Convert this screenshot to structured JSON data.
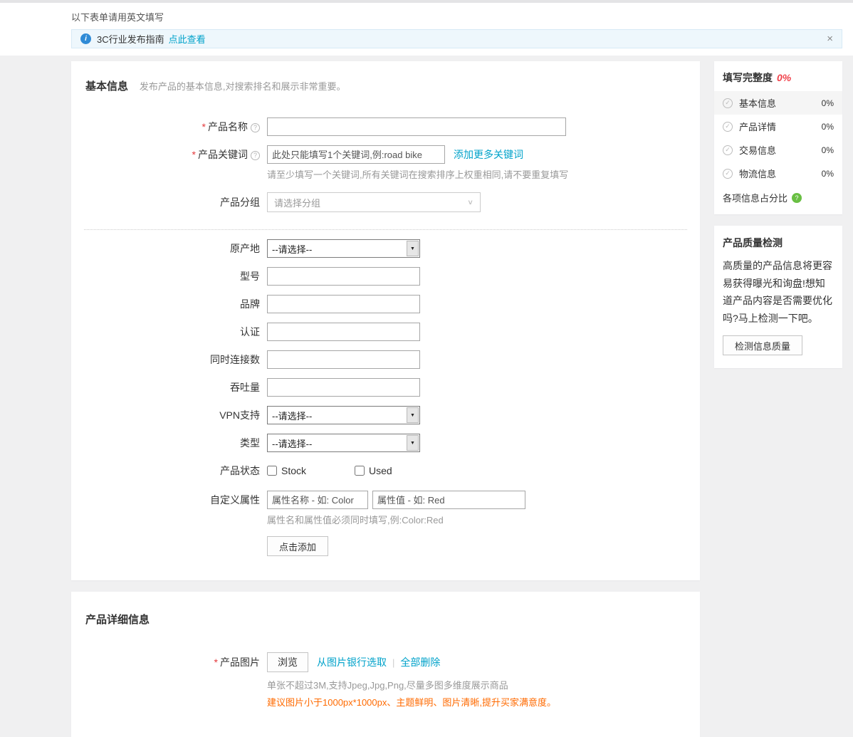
{
  "icons": {
    "info": "i",
    "help": "?",
    "check": "✓",
    "question": "?",
    "close": "×",
    "chevron": "∨",
    "select_arrow": "▼"
  },
  "marks": {
    "required": "*",
    "pipe": "|"
  },
  "top_note": "以下表单请用英文填写",
  "banner": {
    "title": "3C行业发布指南",
    "link": "点此查看"
  },
  "basic": {
    "title": "基本信息",
    "subtitle": "发布产品的基本信息,对搜索排名和展示非常重要。",
    "name_label": "产品名称",
    "keyword_label": "产品关键词",
    "keyword_placeholder": "此处只能填写1个关键词,例:road bike",
    "keyword_add_link": "添加更多关键词",
    "keyword_help": "请至少填写一个关键词,所有关键词在搜索排序上权重相同,请不要重复填写",
    "group_label": "产品分组",
    "group_placeholder": "请选择分组",
    "select_placeholder": "--请选择--",
    "origin_label": "原产地",
    "model_label": "型号",
    "brand_label": "品牌",
    "cert_label": "认证",
    "connections_label": "同时连接数",
    "throughput_label": "吞吐量",
    "vpn_label": "VPN支持",
    "type_label": "类型",
    "status_label": "产品状态",
    "status_options": [
      "Stock",
      "Used"
    ],
    "custom_label": "自定义属性",
    "custom_name_placeholder": "属性名称 - 如: Color",
    "custom_value_placeholder": "属性值 - 如: Red",
    "custom_help": "属性名和属性值必须同时填写,例:Color:Red",
    "custom_add_button": "点击添加"
  },
  "detail": {
    "title": "产品详细信息",
    "image_label": "产品图片",
    "browse_button": "浏览",
    "bank_link": "从图片银行选取",
    "delete_link": "全部删除",
    "help1": "单张不超过3M,支持Jpeg,Jpg,Png,尽量多图多维度展示商品",
    "help2": "建议图片小于1000px*1000px、主题鲜明、图片清晰,提升买家满意度。"
  },
  "sidebar": {
    "completeness": {
      "title": "填写完整度",
      "percent": "0%",
      "items": [
        {
          "label": "基本信息",
          "value": "0%"
        },
        {
          "label": "产品详情",
          "value": "0%"
        },
        {
          "label": "交易信息",
          "value": "0%"
        },
        {
          "label": "物流信息",
          "value": "0%"
        }
      ],
      "footer": "各项信息占分比"
    },
    "quality": {
      "title": "产品质量检测",
      "text": "高质量的产品信息将更容易获得曝光和询盘!想知道产品内容是否需要优化吗?马上检测一下吧。",
      "button": "检测信息质量"
    }
  }
}
